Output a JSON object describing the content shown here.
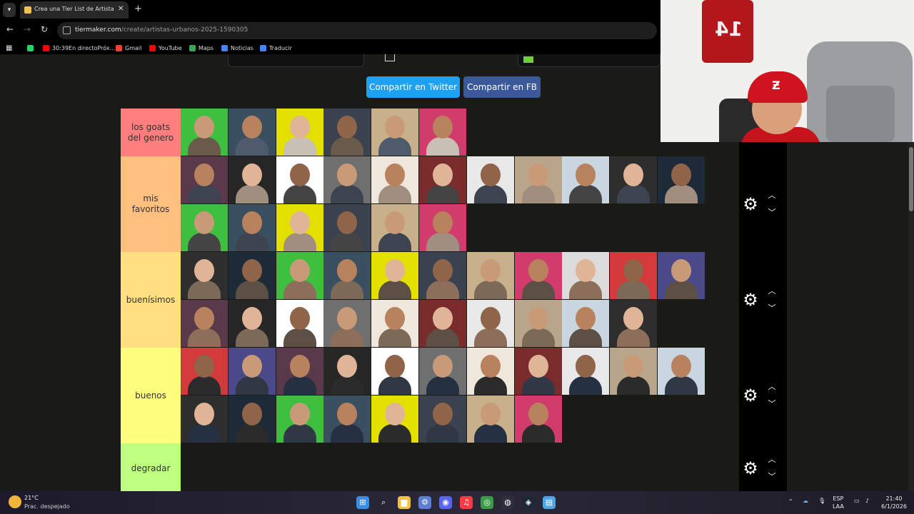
{
  "browser": {
    "tab_title": "Crea una Tier List de Artistas Ur",
    "new_tab": "+",
    "close_tab": "✕",
    "url_domain": "tiermaker.com",
    "url_path": "/create/artistas-urbanos-2025-1590305",
    "bookmarks": [
      {
        "label": "",
        "icon": "whatsapp-icon",
        "color": "#25d366"
      },
      {
        "label": "30:39En directoPróx...",
        "icon": "youtube-icon",
        "color": "#ff0000"
      },
      {
        "label": "Gmail",
        "icon": "gmail-icon",
        "color": "#ea4335"
      },
      {
        "label": "YouTube",
        "icon": "youtube-icon",
        "color": "#ff0000"
      },
      {
        "label": "Maps",
        "icon": "maps-icon",
        "color": "#34a853"
      },
      {
        "label": "Noticias",
        "icon": "news-icon",
        "color": "#4285f4"
      },
      {
        "label": "Traducir",
        "icon": "translate-icon",
        "color": "#4285f4"
      }
    ]
  },
  "share": {
    "twitter_label": "Compartir en Twitter",
    "twitter_color": "#1da1f2",
    "fb_label": "Compartir en FB",
    "fb_color": "#3b5998"
  },
  "tiers": [
    {
      "label": "los goats del genero",
      "color": "#ff7f7f",
      "item_count": 6
    },
    {
      "label": "mis favoritos",
      "color": "#ffbf7f",
      "item_count": 17
    },
    {
      "label": "buenísimos",
      "color": "#ffdf7f",
      "item_count": 21
    },
    {
      "label": "buenos",
      "color": "#ffff7f",
      "item_count": 19
    },
    {
      "label": "degradar",
      "color": "#bfff7f",
      "item_count": 0
    }
  ],
  "webcam": {
    "jersey_number": "14",
    "cap_logo": "Ƶ"
  },
  "taskbar": {
    "weather_temp": "21°C",
    "weather_desc": "Prac. despejado",
    "language_top": "ESP",
    "language_bottom": "LAA",
    "time": "21:40",
    "date": "6/1/2026",
    "apps": [
      {
        "name": "start-icon",
        "glyph": "⊞",
        "color": "#3a8ee6"
      },
      {
        "name": "search-icon",
        "glyph": "⌕",
        "color": "transparent"
      },
      {
        "name": "file-explorer-icon",
        "glyph": "▆",
        "color": "#f2c23a"
      },
      {
        "name": "settings-app-icon",
        "glyph": "⚙",
        "color": "#5b7fd6"
      },
      {
        "name": "discord-icon",
        "glyph": "◉",
        "color": "#5865f2"
      },
      {
        "name": "music-icon",
        "glyph": "♫",
        "color": "#fc3c44"
      },
      {
        "name": "chrome-icon",
        "glyph": "◎",
        "color": "#3c9b47"
      },
      {
        "name": "obs-icon",
        "glyph": "◍",
        "color": "#302e38"
      },
      {
        "name": "steam-icon",
        "glyph": "◈",
        "color": "#1b2838"
      },
      {
        "name": "notepad-icon",
        "glyph": "▤",
        "color": "#4aa6e8"
      }
    ]
  }
}
